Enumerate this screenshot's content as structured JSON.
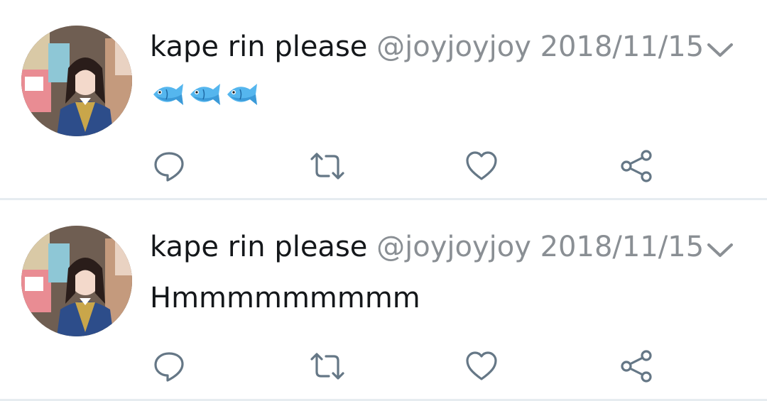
{
  "colors": {
    "name": "#14171a",
    "muted": "#8a8f94",
    "icon": "#657786",
    "divider": "#e6ecf0"
  },
  "tweets": [
    {
      "author_name": "kape rin please",
      "handle": "@joyjoyjoy",
      "date": "2018/11/15",
      "content": "🐟🐟🐟",
      "content_icons": [
        "fish-emoji",
        "fish-emoji",
        "fish-emoji"
      ]
    },
    {
      "author_name": "kape rin please",
      "handle": "@joyjoyjoy",
      "date": "2018/11/15",
      "content": "Hmmmmmmmmm"
    }
  ],
  "actions": [
    "reply-icon",
    "retweet-icon",
    "like-icon",
    "share-icon"
  ]
}
